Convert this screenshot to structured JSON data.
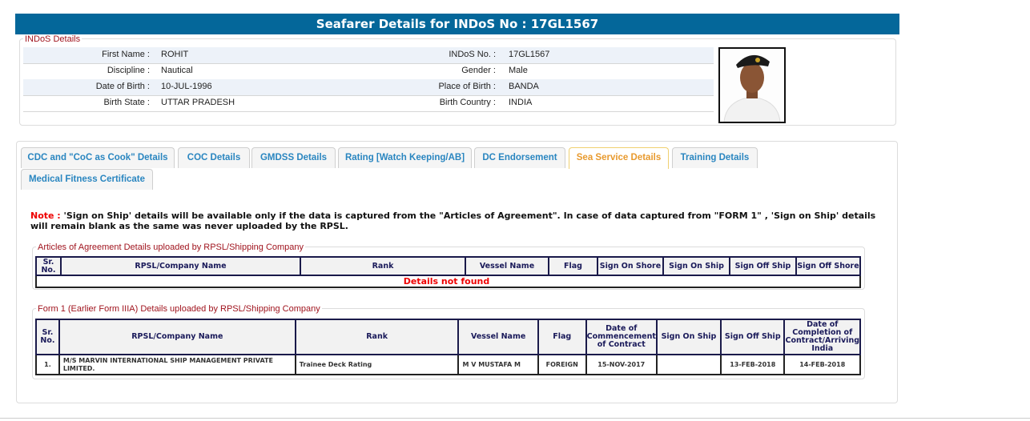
{
  "header": {
    "title": "Seafarer Details for INDoS No : 17GL1567"
  },
  "indos": {
    "legend": "INDoS Details",
    "rows": [
      {
        "l1": "First Name :",
        "v1": "ROHIT",
        "l2": "INDoS No. :",
        "v2": "17GL1567"
      },
      {
        "l1": "Discipline :",
        "v1": "Nautical",
        "l2": "Gender :",
        "v2": "Male"
      },
      {
        "l1": "Date of Birth :",
        "v1": "10-JUL-1996",
        "l2": "Place of Birth :",
        "v2": "BANDA"
      },
      {
        "l1": "Birth State :",
        "v1": "UTTAR PRADESH",
        "l2": "Birth Country :",
        "v2": "INDIA"
      }
    ]
  },
  "tabs": [
    "CDC and \"CoC as Cook\" Details",
    "COC Details",
    "GMDSS Details",
    "Rating [Watch Keeping/AB]",
    "DC Endorsement",
    "Sea Service Details",
    "Training Details",
    "Medical Fitness Certificate"
  ],
  "active_tab": "Sea Service Details",
  "note": {
    "label": "Note :",
    "text": " 'Sign on Ship' details will be available only if the data is captured from the \"Articles of Agreement\". In case of data captured from \"FORM 1\" , 'Sign on Ship' details will remain blank as the same was never uploaded by the RPSL."
  },
  "aoa": {
    "legend": "Articles of Agreement Details uploaded by RPSL/Shipping Company",
    "columns": [
      "Sr. No.",
      "RPSL/Company Name",
      "Rank",
      "Vessel Name",
      "Flag",
      "Sign On Shore",
      "Sign On Ship",
      "Sign Off Ship",
      "Sign Off Shore"
    ],
    "empty": "Details not found"
  },
  "form1": {
    "legend": "Form 1 (Earlier Form IIIA) Details uploaded by RPSL/Shipping Company",
    "columns": [
      "Sr. No.",
      "RPSL/Company Name",
      "Rank",
      "Vessel Name",
      "Flag",
      "Date of Commencement of Contract",
      "Sign On Ship",
      "Sign Off Ship",
      "Date of Completion of Contract/Arriving India"
    ],
    "rows": [
      [
        "1.",
        "M/S MARVIN INTERNATIONAL SHIP MANAGEMENT PRIVATE LIMITED.",
        "Trainee Deck Rating",
        "M V MUSTAFA M",
        "FOREIGN",
        "15-NOV-2017",
        "",
        "13-FEB-2018",
        "14-FEB-2018"
      ]
    ]
  },
  "colors": {
    "header": "#04679a",
    "legend": "#a0141e",
    "tab": "#2a86c0",
    "active_tab": "#e89a2e"
  }
}
